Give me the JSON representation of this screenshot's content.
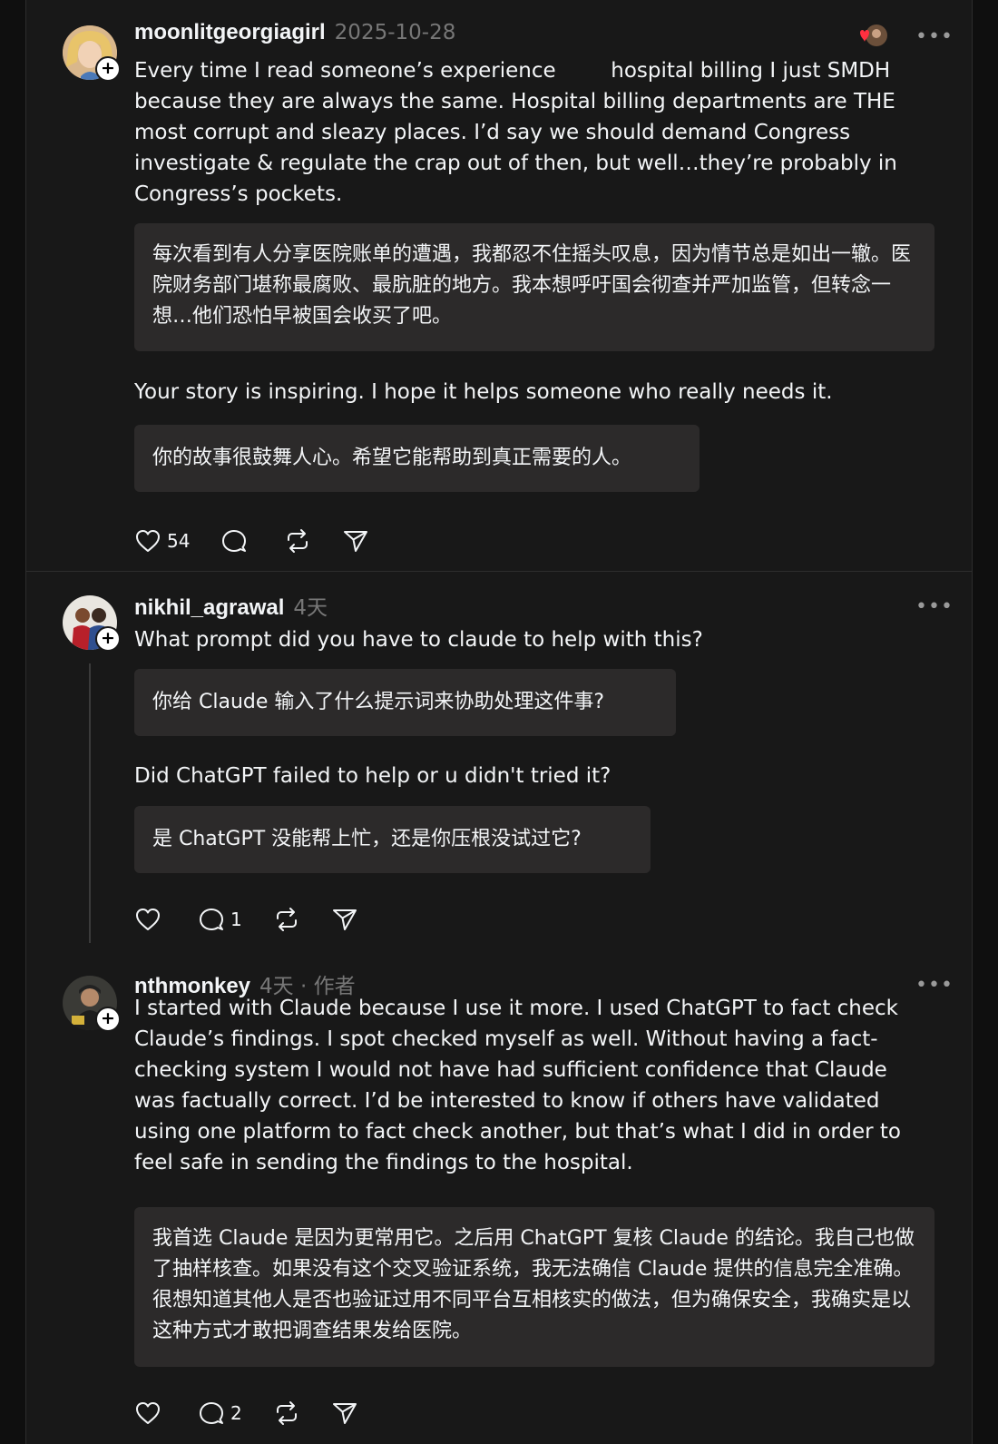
{
  "posts": [
    {
      "username": "moonlitgeorgiagirl",
      "meta": "2025-10-28",
      "body": "Every time I read someone’s experience    hospital billing I just SMDH because they are always the same. Hospital billing departments are THE most corrupt and sleazy places. I’d say we should demand Congress investigate & regulate the crap out of then, but well…they’re probably in Congress’s pockets.",
      "translation1": "每次看到有人分享医院账单的遭遇，我都忍不住摇头叹息，因为情节总是如出一辙。医院财务部门堪称最腐败、最肮脏的地方。我本想呼吁国会彻查并严加监管，但转念一想…他们恐怕早被国会收买了吧。",
      "body2": "Your story is inspiring. I hope it helps someone who really needs it.",
      "translation2": "你的故事很鼓舞人心。希望它能帮助到真正需要的人。",
      "likes": "54",
      "replies": ""
    },
    {
      "username": "nikhil_agrawal",
      "meta": "4天",
      "body": "What prompt did you have to claude to help with this?",
      "translation1": "你给 Claude 输入了什么提示词来协助处理这件事?",
      "body2": "Did ChatGPT failed to help or u didn't tried it?",
      "translation2": "是 ChatGPT 没能帮上忙，还是你压根没试过它?",
      "likes": "",
      "replies": "1"
    },
    {
      "username": "nthmonkey",
      "meta": "4天 · 作者",
      "body": "I started with Claude because I use it more. I used ChatGPT to fact check Claude’s findings. I spot checked myself as well. Without having a fact-checking system I would not have had sufficient confidence that Claude was factually correct. I’d be interested to know if others have validated using one platform to fact check another, but that’s what I did in order to feel safe in sending the findings to the hospital.",
      "translation1": "我首选 Claude 是因为更常用它。之后用 ChatGPT 复核 Claude 的结论。我自己也做了抽样核查。如果没有这个交叉验证系统，我无法确信 Claude 提供的信息完全准确。很想知道其他人是否也验证过用不同平台互相核实的做法，但为确保安全，我确实是以这种方式才敢把调查结果发给医院。",
      "likes": "",
      "replies": "2"
    }
  ],
  "icons": {
    "like": "heart-icon",
    "reply": "comment-icon",
    "repost": "repost-icon",
    "share": "send-icon",
    "more": "more-icon",
    "follow": "plus-icon"
  },
  "colors": {
    "background": "#181818",
    "translation_box": "#2c2a2a",
    "text": "#f3f5f7",
    "muted": "#777777",
    "reaction": "#ff3040"
  }
}
